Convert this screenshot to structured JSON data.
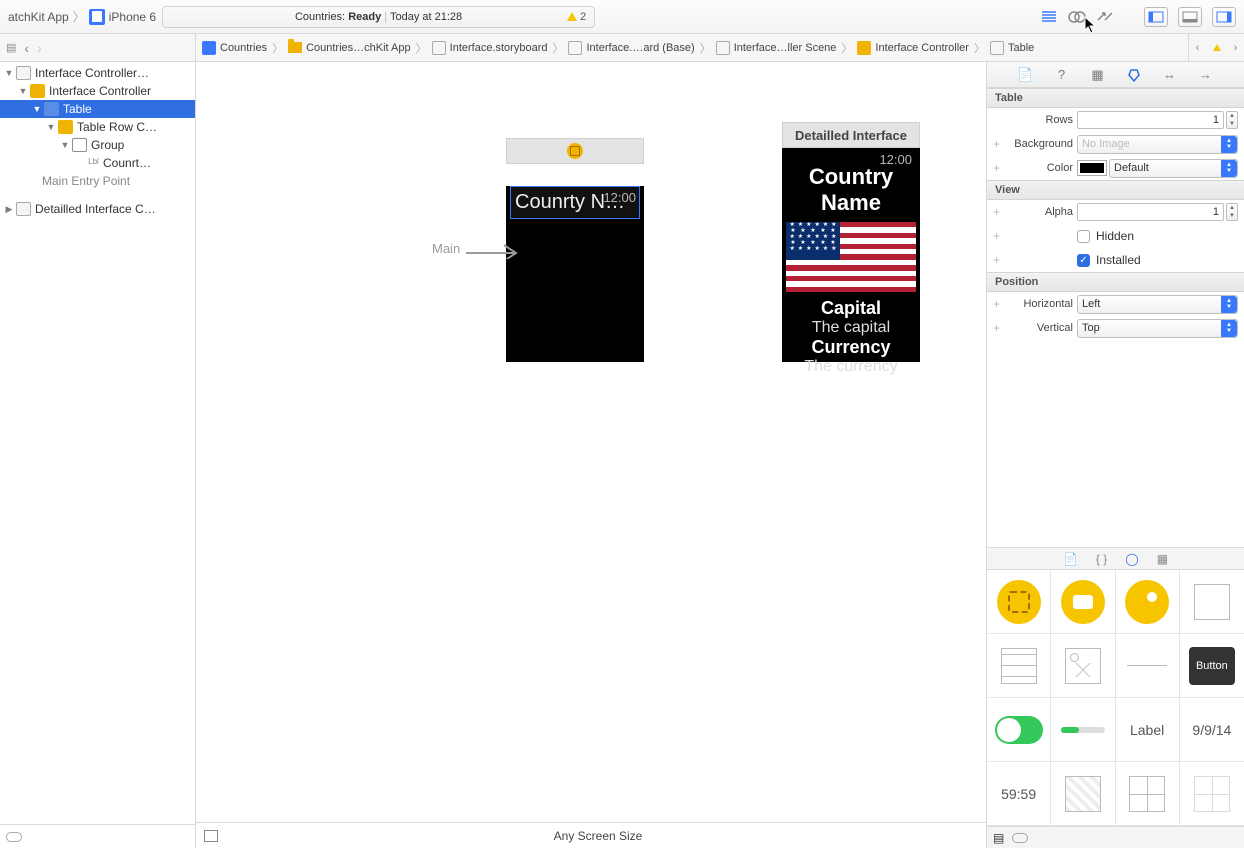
{
  "toolbar": {
    "scheme": "atchKit App",
    "device": "iPhone 6",
    "status_prefix": "Countries:",
    "status_word": "Ready",
    "status_time": "Today at 21:28",
    "warnings": "2"
  },
  "jumpbar": {
    "items": [
      "Countries",
      "Countries…chKit App",
      "Interface.storyboard",
      "Interface.…ard (Base)",
      "Interface…ller Scene",
      "Interface Controller",
      "Table"
    ]
  },
  "navigator": {
    "rows": [
      {
        "indent": 0,
        "disc": "▼",
        "icon": "story",
        "label": "Interface Controller…"
      },
      {
        "indent": 1,
        "disc": "▼",
        "icon": "int",
        "label": "Interface Controller"
      },
      {
        "indent": 2,
        "disc": "▼",
        "icon": "table",
        "label": "Table",
        "selected": true
      },
      {
        "indent": 3,
        "disc": "▼",
        "icon": "int",
        "label": "Table Row C…"
      },
      {
        "indent": 4,
        "disc": "▼",
        "icon": "group",
        "label": "Group"
      },
      {
        "indent": 5,
        "disc": "",
        "icon": "lbl",
        "label": "Counrt…"
      },
      {
        "indent": 1,
        "disc": "",
        "icon": "none",
        "label": "Main Entry Point",
        "dim": true
      },
      {
        "indent": 0,
        "disc": "▶",
        "icon": "story",
        "label": "Detailled Interface C…"
      }
    ]
  },
  "canvas": {
    "main_label": "Main",
    "screen_size": "Any Screen Size",
    "scene1": {
      "time": "12:00",
      "row_label": "Counrty Na…"
    },
    "scene2": {
      "title": "Detailled Interface",
      "time": "12:00",
      "country": "Country Name",
      "capital_h": "Capital",
      "capital_v": "The capital",
      "currency_h": "Currency",
      "currency_v": "The currency"
    }
  },
  "inspector": {
    "sections": {
      "table": "Table",
      "view": "View",
      "position": "Position"
    },
    "rows_label": "Rows",
    "rows_value": "1",
    "background_label": "Background",
    "background_value": "No Image",
    "color_label": "Color",
    "color_value": "Default",
    "alpha_label": "Alpha",
    "alpha_value": "1",
    "hidden_label": "Hidden",
    "installed_label": "Installed",
    "horizontal_label": "Horizontal",
    "horizontal_value": "Left",
    "vertical_label": "Vertical",
    "vertical_value": "Top"
  },
  "library": {
    "button": "Button",
    "label": "Label",
    "date": "9/9/14",
    "timer": "59:59"
  }
}
